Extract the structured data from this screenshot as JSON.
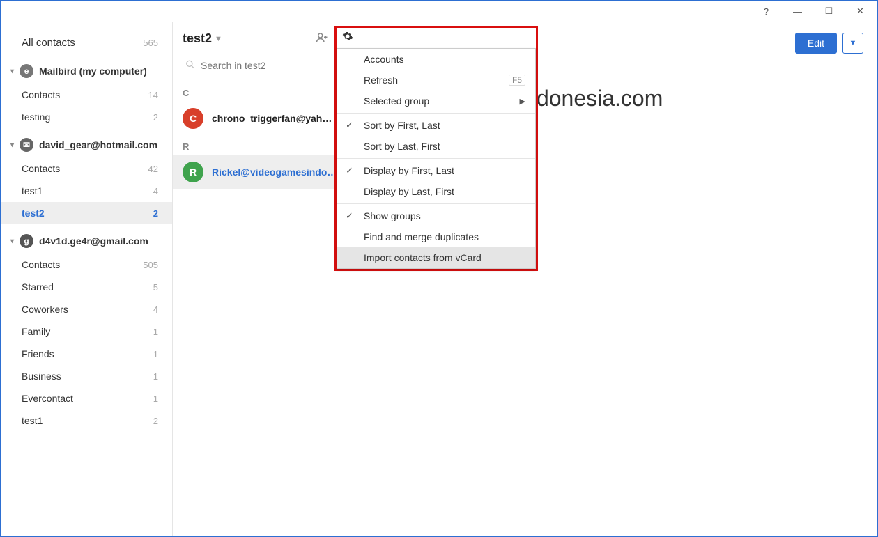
{
  "titlebar": {
    "help": "?",
    "min": "—",
    "max": "☐",
    "close": "✕"
  },
  "sidebar": {
    "all_label": "All contacts",
    "all_count": "565",
    "accounts": [
      {
        "name": "Mailbird (my computer)",
        "icon": "e",
        "icon_class": "mb",
        "items": [
          {
            "label": "Contacts",
            "count": "14",
            "selected": false
          },
          {
            "label": "testing",
            "count": "2",
            "selected": false
          }
        ]
      },
      {
        "name": "david_gear@hotmail.com",
        "icon": "✉",
        "icon_class": "ol",
        "items": [
          {
            "label": "Contacts",
            "count": "42",
            "selected": false
          },
          {
            "label": "test1",
            "count": "4",
            "selected": false
          },
          {
            "label": "test2",
            "count": "2",
            "selected": true
          }
        ]
      },
      {
        "name": "d4v1d.ge4r@gmail.com",
        "icon": "g",
        "icon_class": "gm",
        "items": [
          {
            "label": "Contacts",
            "count": "505",
            "selected": false
          },
          {
            "label": "Starred",
            "count": "5",
            "selected": false
          },
          {
            "label": "Coworkers",
            "count": "4",
            "selected": false
          },
          {
            "label": "Family",
            "count": "1",
            "selected": false
          },
          {
            "label": "Friends",
            "count": "1",
            "selected": false
          },
          {
            "label": "Business",
            "count": "1",
            "selected": false
          },
          {
            "label": "Evercontact",
            "count": "1",
            "selected": false
          },
          {
            "label": "test1",
            "count": "2",
            "selected": false
          }
        ]
      }
    ]
  },
  "middle": {
    "group_title": "test2",
    "search_placeholder": "Search in test2",
    "sections": [
      {
        "letter": "C",
        "contacts": [
          {
            "initial": "C",
            "avatar_class": "c",
            "name": "chrono_triggerfan@yahoo...",
            "selected": false
          }
        ]
      },
      {
        "letter": "R",
        "contacts": [
          {
            "initial": "R",
            "avatar_class": "r",
            "name": "Rickel@videogamesindon...",
            "selected": true
          }
        ]
      }
    ]
  },
  "detail": {
    "edit_label": "Edit",
    "name": "@videogamesindonesia.com",
    "email_partial": "ia.com"
  },
  "menu": {
    "accounts": "Accounts",
    "refresh": "Refresh",
    "refresh_key": "F5",
    "selected_group": "Selected group",
    "sort_first_last": "Sort by First, Last",
    "sort_last_first": "Sort by Last, First",
    "display_first_last": "Display by First, Last",
    "display_last_first": "Display by Last, First",
    "show_groups": "Show groups",
    "find_merge": "Find and merge duplicates",
    "import_vcard": "Import contacts from vCard"
  }
}
